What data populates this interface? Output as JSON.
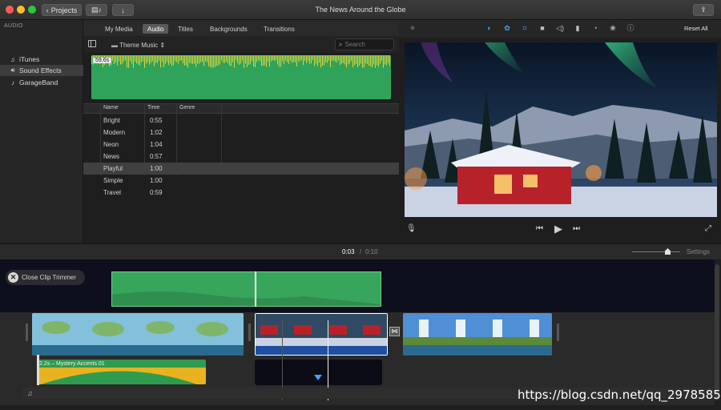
{
  "window": {
    "title": "The News Around the Globe",
    "projects_label": "Projects"
  },
  "sidebar": {
    "header": "AUDIO",
    "items": [
      {
        "label": "iTunes",
        "icon": "music-note-icon"
      },
      {
        "label": "Sound Effects",
        "icon": "speaker-icon",
        "selected": true
      },
      {
        "label": "GarageBand",
        "icon": "guitar-icon"
      }
    ]
  },
  "tabs": [
    {
      "label": "My Media"
    },
    {
      "label": "Audio",
      "selected": true
    },
    {
      "label": "Titles"
    },
    {
      "label": "Backgrounds"
    },
    {
      "label": "Transitions"
    }
  ],
  "browser": {
    "source_label": "Theme Music",
    "search_placeholder": "Search",
    "waveform_duration": "59.6s",
    "columns": [
      "Name",
      "Time",
      "Genre"
    ],
    "rows": [
      {
        "name": "Bright",
        "time": "0:55"
      },
      {
        "name": "Modern",
        "time": "1:02"
      },
      {
        "name": "Neon",
        "time": "1:04"
      },
      {
        "name": "News",
        "time": "0:57"
      },
      {
        "name": "Playful",
        "time": "1:00",
        "selected": true
      },
      {
        "name": "Simple",
        "time": "1:00"
      },
      {
        "name": "Travel",
        "time": "0:59"
      }
    ]
  },
  "viewer": {
    "reset_label": "Reset All"
  },
  "timebar": {
    "current": "0:03",
    "separator": "/",
    "total": "0:10",
    "settings_label": "Settings"
  },
  "timeline": {
    "close_trimmer_label": "Close Clip Trimmer",
    "audio_clip_label": "2.2s – Mystery Accents 01"
  },
  "watermark": "https://blog.csdn.net/qq_29785857",
  "colors": {
    "accent_green": "#2fa35a",
    "selected_blue": "#1f4fa0",
    "playhead": "#4a9eff"
  }
}
